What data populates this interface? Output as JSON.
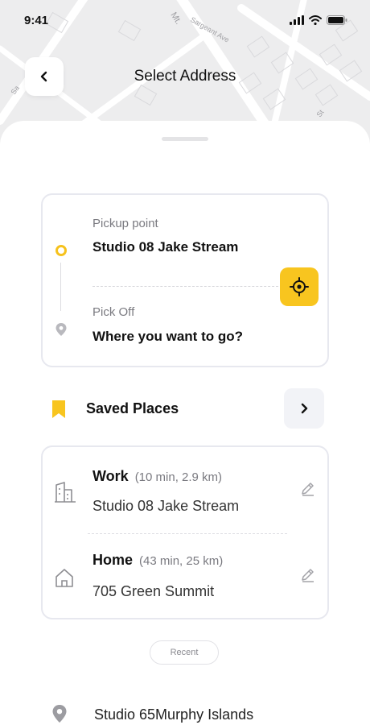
{
  "status_bar": {
    "time": "9:41",
    "signal_icon": "signal-icon",
    "wifi_icon": "wifi-icon",
    "battery_icon": "battery-icon"
  },
  "map": {
    "street_labels": [
      "Mt.",
      "Sargeant Ave",
      "Sa",
      "St"
    ]
  },
  "header": {
    "title": "Select Address",
    "back_icon": "chevron-left-icon"
  },
  "route": {
    "pickup_label": "Pickup point",
    "pickup_value": "Studio 08 Jake Stream",
    "dropoff_label": "Pick Off",
    "dropoff_placeholder": "Where you want to go?",
    "locate_icon": "crosshair-icon"
  },
  "saved": {
    "title": "Saved Places",
    "places": [
      {
        "name": "Work",
        "meta": "(10 min, 2.9 km)",
        "address": "Studio 08 Jake Stream",
        "icon": "building-icon"
      },
      {
        "name": "Home",
        "meta": "(43 min, 25 km)",
        "address": "705 Green Summit",
        "icon": "home-icon"
      }
    ]
  },
  "recent": {
    "chip_label": "Recent",
    "items": [
      {
        "address": "Studio 65Murphy Islands",
        "icon": "location-pin-icon"
      }
    ]
  },
  "colors": {
    "accent": "#F8C51F",
    "border": "#E7E8EF",
    "muted_text": "#7A7A80"
  }
}
